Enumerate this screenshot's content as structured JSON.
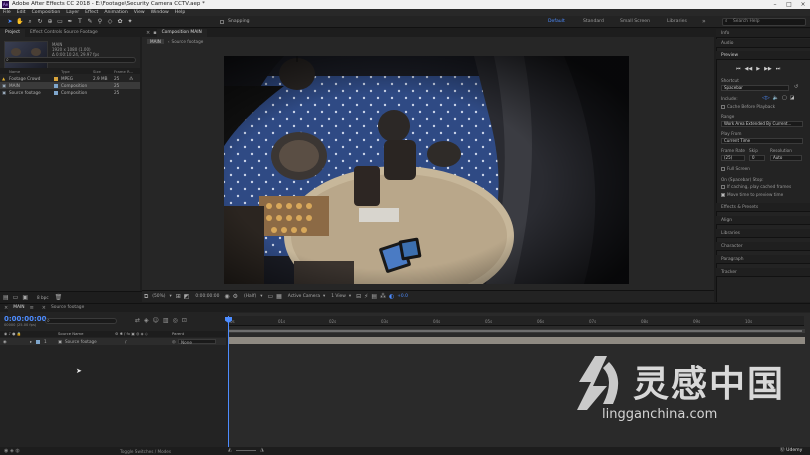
{
  "window": {
    "app_icon": "Ae",
    "title": "Adobe After Effects CC 2018 - E:\\Footage\\Security Camera CCTV.aep *"
  },
  "menu": [
    "File",
    "Edit",
    "Composition",
    "Layer",
    "Effect",
    "Animation",
    "View",
    "Window",
    "Help"
  ],
  "toolbar": {
    "snapping_label": "Snapping",
    "workspaces": [
      "Default",
      "Standard",
      "Small Screen",
      "Libraries"
    ],
    "active_workspace": "Default",
    "search_placeholder": "Search Help"
  },
  "project_panel": {
    "tabs": [
      "Project",
      "Effect Controls Source Footage"
    ],
    "selected_item": "MAIN",
    "info_line1": "1920 x 1080 (1.00)",
    "info_line2": "Δ 0:00:10:24, 29.97 fps",
    "columns": [
      "Name",
      "Type",
      "Size",
      "Frame R..."
    ],
    "items": [
      {
        "name": "Footage Crowd",
        "type": "MPEG",
        "size": "2.9 MB",
        "fps": "25",
        "color": "#d9a43b"
      },
      {
        "name": "MAIN",
        "type": "Composition",
        "size": "",
        "fps": "25",
        "color": "#7fa6cc"
      },
      {
        "name": "Source footage",
        "type": "Composition",
        "size": "",
        "fps": "25",
        "color": "#7fa6cc"
      }
    ],
    "bpc": "8 bpc"
  },
  "composition_panel": {
    "tab_label": "Composition MAIN",
    "breadcrumbs": [
      "MAIN",
      "Source footage"
    ],
    "footer": {
      "zoom": "(50%)",
      "timecode": "0:00:00:00",
      "resolution": "(Half)",
      "camera": "Active Camera",
      "views": "1 View",
      "exposure": "+0.0"
    }
  },
  "right_panel": {
    "sections_top": [
      "Info",
      "Audio"
    ],
    "preview_title": "Preview",
    "shortcut_label": "Shortcut",
    "shortcut_value": "Spacebar",
    "include_label": "Include:",
    "cache_before_playback": "Cache Before Playback",
    "range_label": "Range",
    "range_value": "Work Area Extended By Current...",
    "play_from_label": "Play From",
    "play_from_value": "Current Time",
    "frame_rate_label": "Frame Rate",
    "skip_label": "Skip",
    "resolution_label": "Resolution",
    "frame_rate_value": "(25)",
    "skip_value": "0",
    "resolution_value": "Auto",
    "full_screen": "Full Screen",
    "on_stop_label": "On (Spacebar) Stop:",
    "if_caching": "If caching, play cached frames",
    "move_time": "Move time to preview time",
    "sections_bottom": [
      "Effects & Presets",
      "Align",
      "Libraries",
      "Character",
      "Paragraph",
      "Tracker"
    ]
  },
  "timeline": {
    "tabs": [
      "MAIN",
      "Source footage"
    ],
    "timecode": "0:00:00:00",
    "timecode_sub": "00000 (25.00 fps)",
    "columns": [
      "Source Name",
      "Parent"
    ],
    "layer": {
      "number": "1",
      "name": "Source footage",
      "parent": "None"
    },
    "ruler_ticks": [
      "0s",
      "01s",
      "02s",
      "03s",
      "04s",
      "05s",
      "06s",
      "07s",
      "08s",
      "09s",
      "10s"
    ],
    "status": "Toggle Switches / Modes"
  },
  "watermark": {
    "chinese": "灵感中国",
    "url": "lingganchina.com",
    "udemy": "Udemy"
  }
}
